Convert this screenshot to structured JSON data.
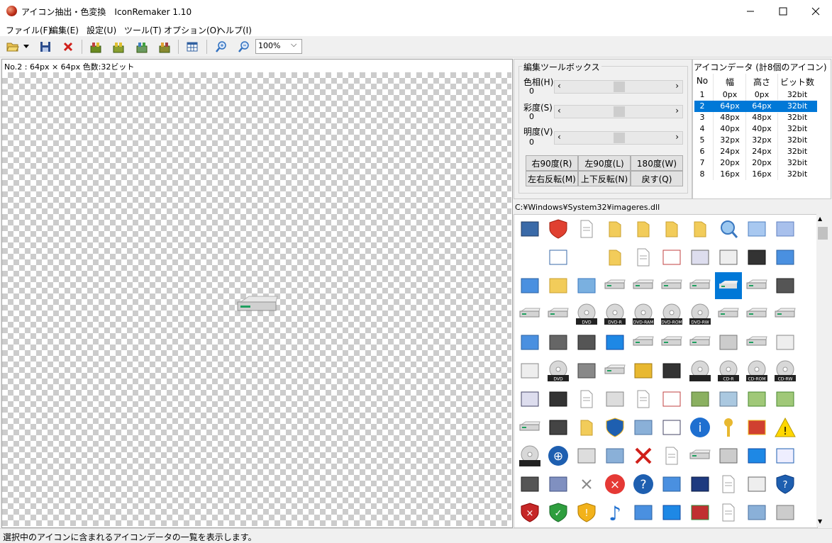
{
  "window": {
    "title": "アイコン抽出・色変換　IconRemaker 1.10",
    "minimize": "–",
    "maximize": "☐",
    "close": "✕"
  },
  "menu": [
    "ファイル(F)",
    "編集(E)",
    "設定(U)",
    "ツール(T)",
    "オプション(O)",
    "ヘルプ(I)"
  ],
  "toolbar": {
    "zoom_value": "100%",
    "zoom_caret": "⌵"
  },
  "left_pane": {
    "header": "No.2 : 64px × 64px  色数:32ビット"
  },
  "toolbox": {
    "title": "編集ツールボックス",
    "sliders": [
      {
        "label": "色相(H)",
        "value": "0"
      },
      {
        "label": "彩度(S)",
        "value": "0"
      },
      {
        "label": "明度(V)",
        "value": "0"
      }
    ],
    "arrow_left": "‹",
    "arrow_right": "›",
    "buttons": [
      "右90度(R)",
      "左90度(L)",
      "180度(W)",
      "左右反転(M)",
      "上下反転(N)",
      "戻す(Q)"
    ]
  },
  "icon_data": {
    "title": "アイコンデータ (計8個のアイコン)",
    "columns": [
      "No",
      "幅",
      "高さ",
      "ビット数"
    ],
    "rows": [
      [
        "1",
        "0px",
        "0px",
        "32bit"
      ],
      [
        "2",
        "64px",
        "64px",
        "32bit"
      ],
      [
        "3",
        "48px",
        "48px",
        "32bit"
      ],
      [
        "4",
        "40px",
        "40px",
        "32bit"
      ],
      [
        "5",
        "32px",
        "32px",
        "32bit"
      ],
      [
        "6",
        "24px",
        "24px",
        "32bit"
      ],
      [
        "7",
        "20px",
        "20px",
        "32bit"
      ],
      [
        "8",
        "16px",
        "16px",
        "32bit"
      ]
    ],
    "selected_row": 2
  },
  "dll": {
    "path": "C:¥Windows¥System32¥imageres.dll",
    "disc_labels": [
      "DVD-R",
      "DVD-RAM",
      "DVD-ROM",
      "DVD-RW",
      "DVD",
      "CD-R",
      "CD-ROM",
      "CD-RW"
    ]
  },
  "status": "選択中のアイコンに含まれるアイコンデータの一覧を表示します。",
  "colors": {
    "selection": "#0078d7",
    "checker": "#cccccc",
    "window_bg": "#f0f0f0"
  }
}
